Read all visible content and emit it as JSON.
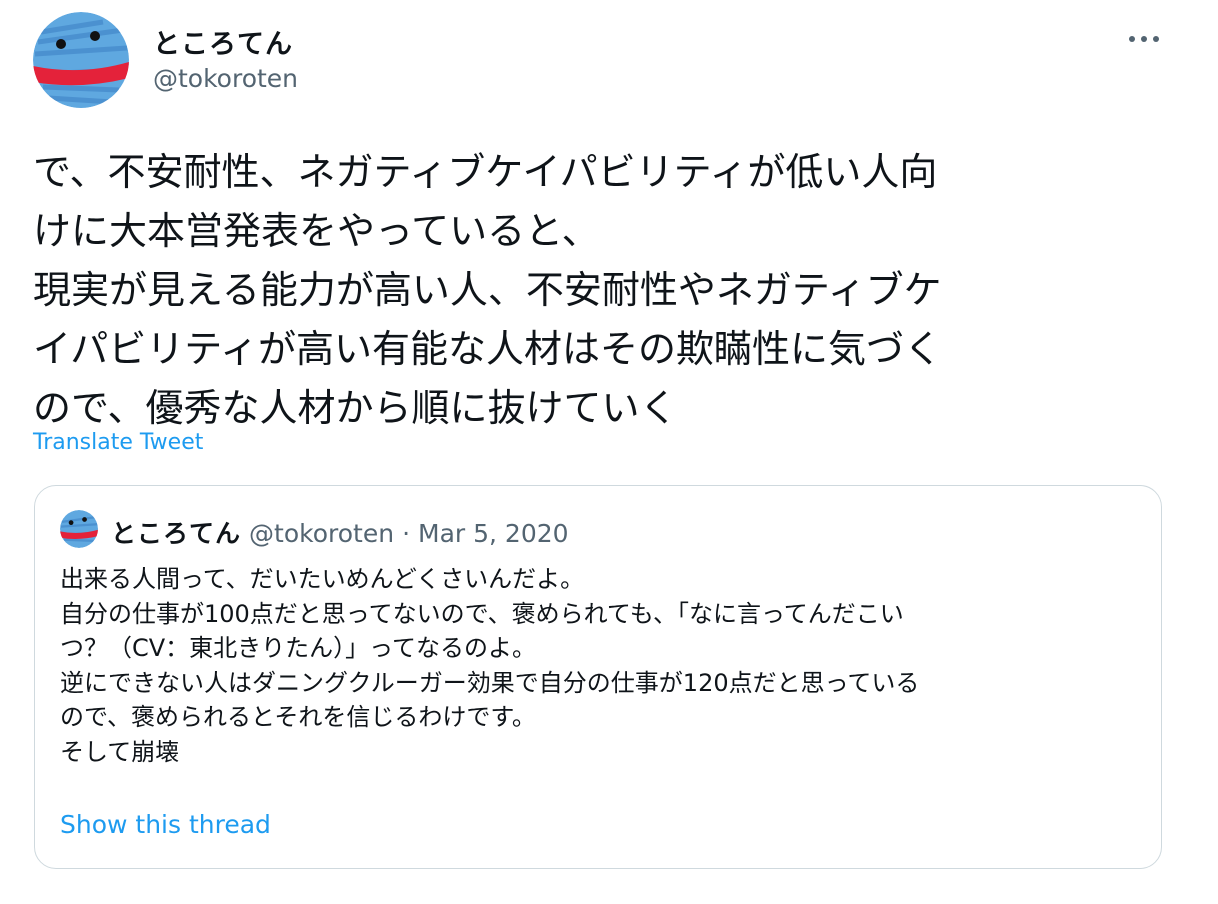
{
  "author": {
    "name": "ところてん",
    "handle": "@tokoroten",
    "avatar_icon": "blue-scribble-face-avatar"
  },
  "menu_icon": "more-horizontal-icon",
  "tweet": {
    "lines": [
      "で、不安耐性、ネガティブケイパビリティが低い人向",
      "けに大本営発表をやっていると、",
      "現実が見える能力が高い人、不安耐性やネガティブケ",
      "イパビリティが高い有能な人材はその欺瞞性に気づく",
      "ので、優秀な人材から順に抜けていく"
    ],
    "translate_label": "Translate Tweet"
  },
  "quote": {
    "name": "ところてん",
    "handle": "@tokoroten",
    "separator": "·",
    "date": "Mar 5, 2020",
    "lines": [
      "出来る人間って、だいたいめんどくさいんだよ。",
      "自分の仕事が100点だと思ってないので、褒められても、「なに言ってんだこい",
      "つ？（CV：東北きりたん）」ってなるのよ。",
      "逆にできない人はダニングクルーガー効果で自分の仕事が120点だと思っている",
      "ので、褒められるとそれを信じるわけです。",
      "そして崩壊"
    ],
    "show_thread_label": "Show this thread"
  },
  "colors": {
    "link": "#1d9bf0",
    "secondary_text": "#536471",
    "primary_text": "#0f1419",
    "border": "#cfd9de"
  }
}
